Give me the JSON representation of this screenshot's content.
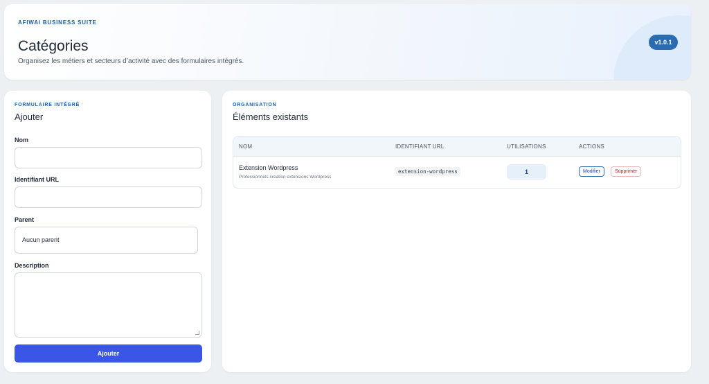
{
  "header": {
    "eyebrow": "AFIWAI BUSINESS SUITE",
    "title": "Catégories",
    "subtitle": "Organisez les métiers et secteurs d’activité avec des formulaires intégrés.",
    "version": "v1.0.1"
  },
  "form": {
    "eyebrow": "FORMULAIRE INTÉGRÉ",
    "title": "Ajouter",
    "fields": {
      "name": {
        "label": "Nom",
        "value": "",
        "placeholder": ""
      },
      "slug": {
        "label": "Identifiant URL",
        "value": "",
        "placeholder": ""
      },
      "parent": {
        "label": "Parent",
        "selected": "Aucun parent"
      },
      "description": {
        "label": "Description",
        "value": ""
      }
    },
    "submit_label": "Ajouter"
  },
  "list": {
    "eyebrow": "ORGANISATION",
    "title": "Éléments existants",
    "columns": [
      "NOM",
      "IDENTIFIANT URL",
      "UTILISATIONS",
      "ACTIONS"
    ],
    "rows": [
      {
        "name": "Extension Wordpress",
        "description": "Professionnels création extensions Wordpress",
        "slug": "extension-wordpress",
        "uses": "1",
        "edit_label": "Modifier",
        "delete_label": "Supprimer"
      }
    ]
  },
  "colors": {
    "accent": "#3b55e6",
    "brand_blue": "#2b6cb0",
    "danger": "#b91c1c",
    "page_bg": "#edf0f3"
  }
}
